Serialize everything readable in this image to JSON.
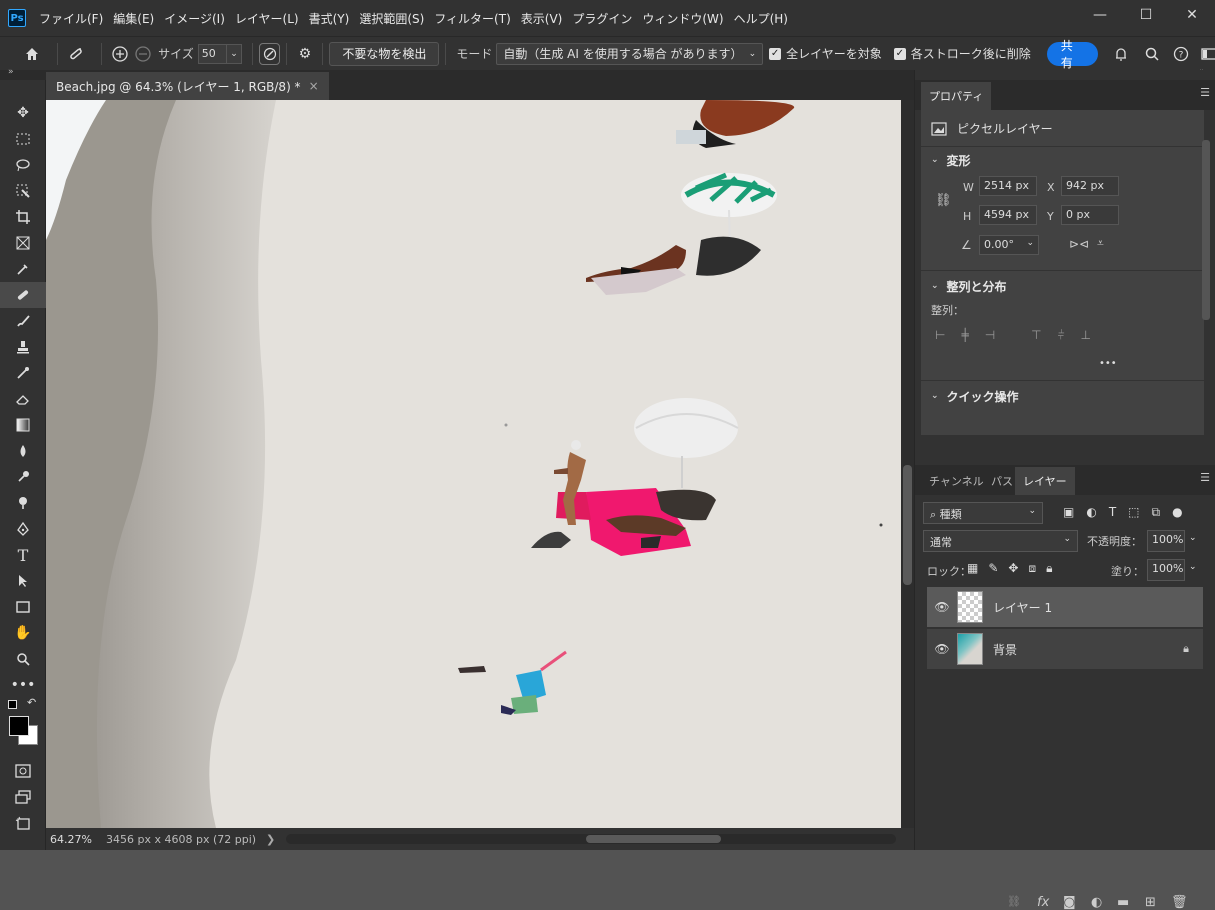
{
  "app": {
    "logo": "Ps"
  },
  "menu": [
    "ファイル(F)",
    "編集(E)",
    "イメージ(I)",
    "レイヤー(L)",
    "書式(Y)",
    "選択範囲(S)",
    "フィルター(T)",
    "表示(V)",
    "プラグイン",
    "ウィンドウ(W)",
    "ヘルプ(H)"
  ],
  "window_controls": {
    "minimize": "—",
    "maximize": "☐",
    "close": "✕"
  },
  "options": {
    "size_label": "サイズ",
    "size_value": "50",
    "detect_button": "不要な物を検出",
    "mode_label": "モード",
    "mode_value": "自動（生成 AI を使用する場合 があります）",
    "all_layers_label": "全レイヤーを対象",
    "all_layers_checked": true,
    "delete_after_label": "各ストローク後に削除",
    "delete_after_checked": true,
    "share_label": "共有"
  },
  "document": {
    "tab_title": "Beach.jpg @ 64.3% (レイヤー 1, RGB/8) *",
    "close": "×"
  },
  "status": {
    "zoom": "64.27%",
    "dims": "3456 px x 4608 px (72 ppi)",
    "arrow": "❯"
  },
  "properties": {
    "tab": "プロパティ",
    "layer_kind": "ピクセルレイヤー",
    "transform_title": "変形",
    "w_label": "W",
    "w_value": "2514 px",
    "h_label": "H",
    "h_value": "4594 px",
    "x_label": "X",
    "x_value": "942 px",
    "y_label": "Y",
    "y_value": "0 px",
    "angle_value": "0.00°",
    "align_title": "整列と分布",
    "align_label": "整列：",
    "quick_title": "クイック操作",
    "more": "•••"
  },
  "layers_panel": {
    "tabs": [
      "チャンネル",
      "パス",
      "レイヤー"
    ],
    "filter_value": "種類",
    "blend_value": "通常",
    "opacity_label": "不透明度：",
    "opacity_value": "100%",
    "lock_label": "ロック：",
    "fill_label": "塗り：",
    "fill_value": "100%",
    "layers": [
      {
        "name": "レイヤー 1"
      },
      {
        "name": "背景"
      }
    ]
  },
  "colors": {
    "accent": "#1473e6",
    "panel": "#323232",
    "canvas_sand": "#e4e1dc"
  }
}
